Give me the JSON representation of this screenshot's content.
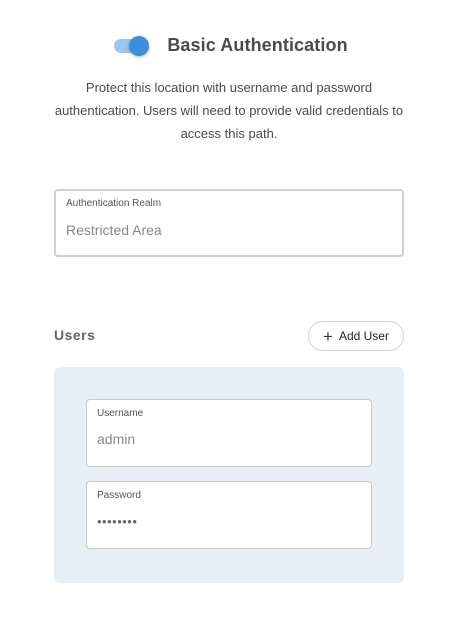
{
  "header": {
    "toggle_on": true,
    "title": "Basic Authentication"
  },
  "description": "Protect this location with username and password authentication. Users will need to provide valid credentials to access this path.",
  "realm_field": {
    "label": "Authentication Realm",
    "value": "Restricted Area"
  },
  "users": {
    "heading": "Users",
    "add_button_label": "Add User",
    "entries": [
      {
        "username_label": "Username",
        "username_value": "admin",
        "password_label": "Password",
        "password_value": "••••••••"
      }
    ]
  },
  "colors": {
    "toggle_thumb": "#3b8ede",
    "toggle_track": "#9cc6ec",
    "user_card_bg": "#e8eef6"
  },
  "icons": {
    "add_user": "plus-icon"
  }
}
